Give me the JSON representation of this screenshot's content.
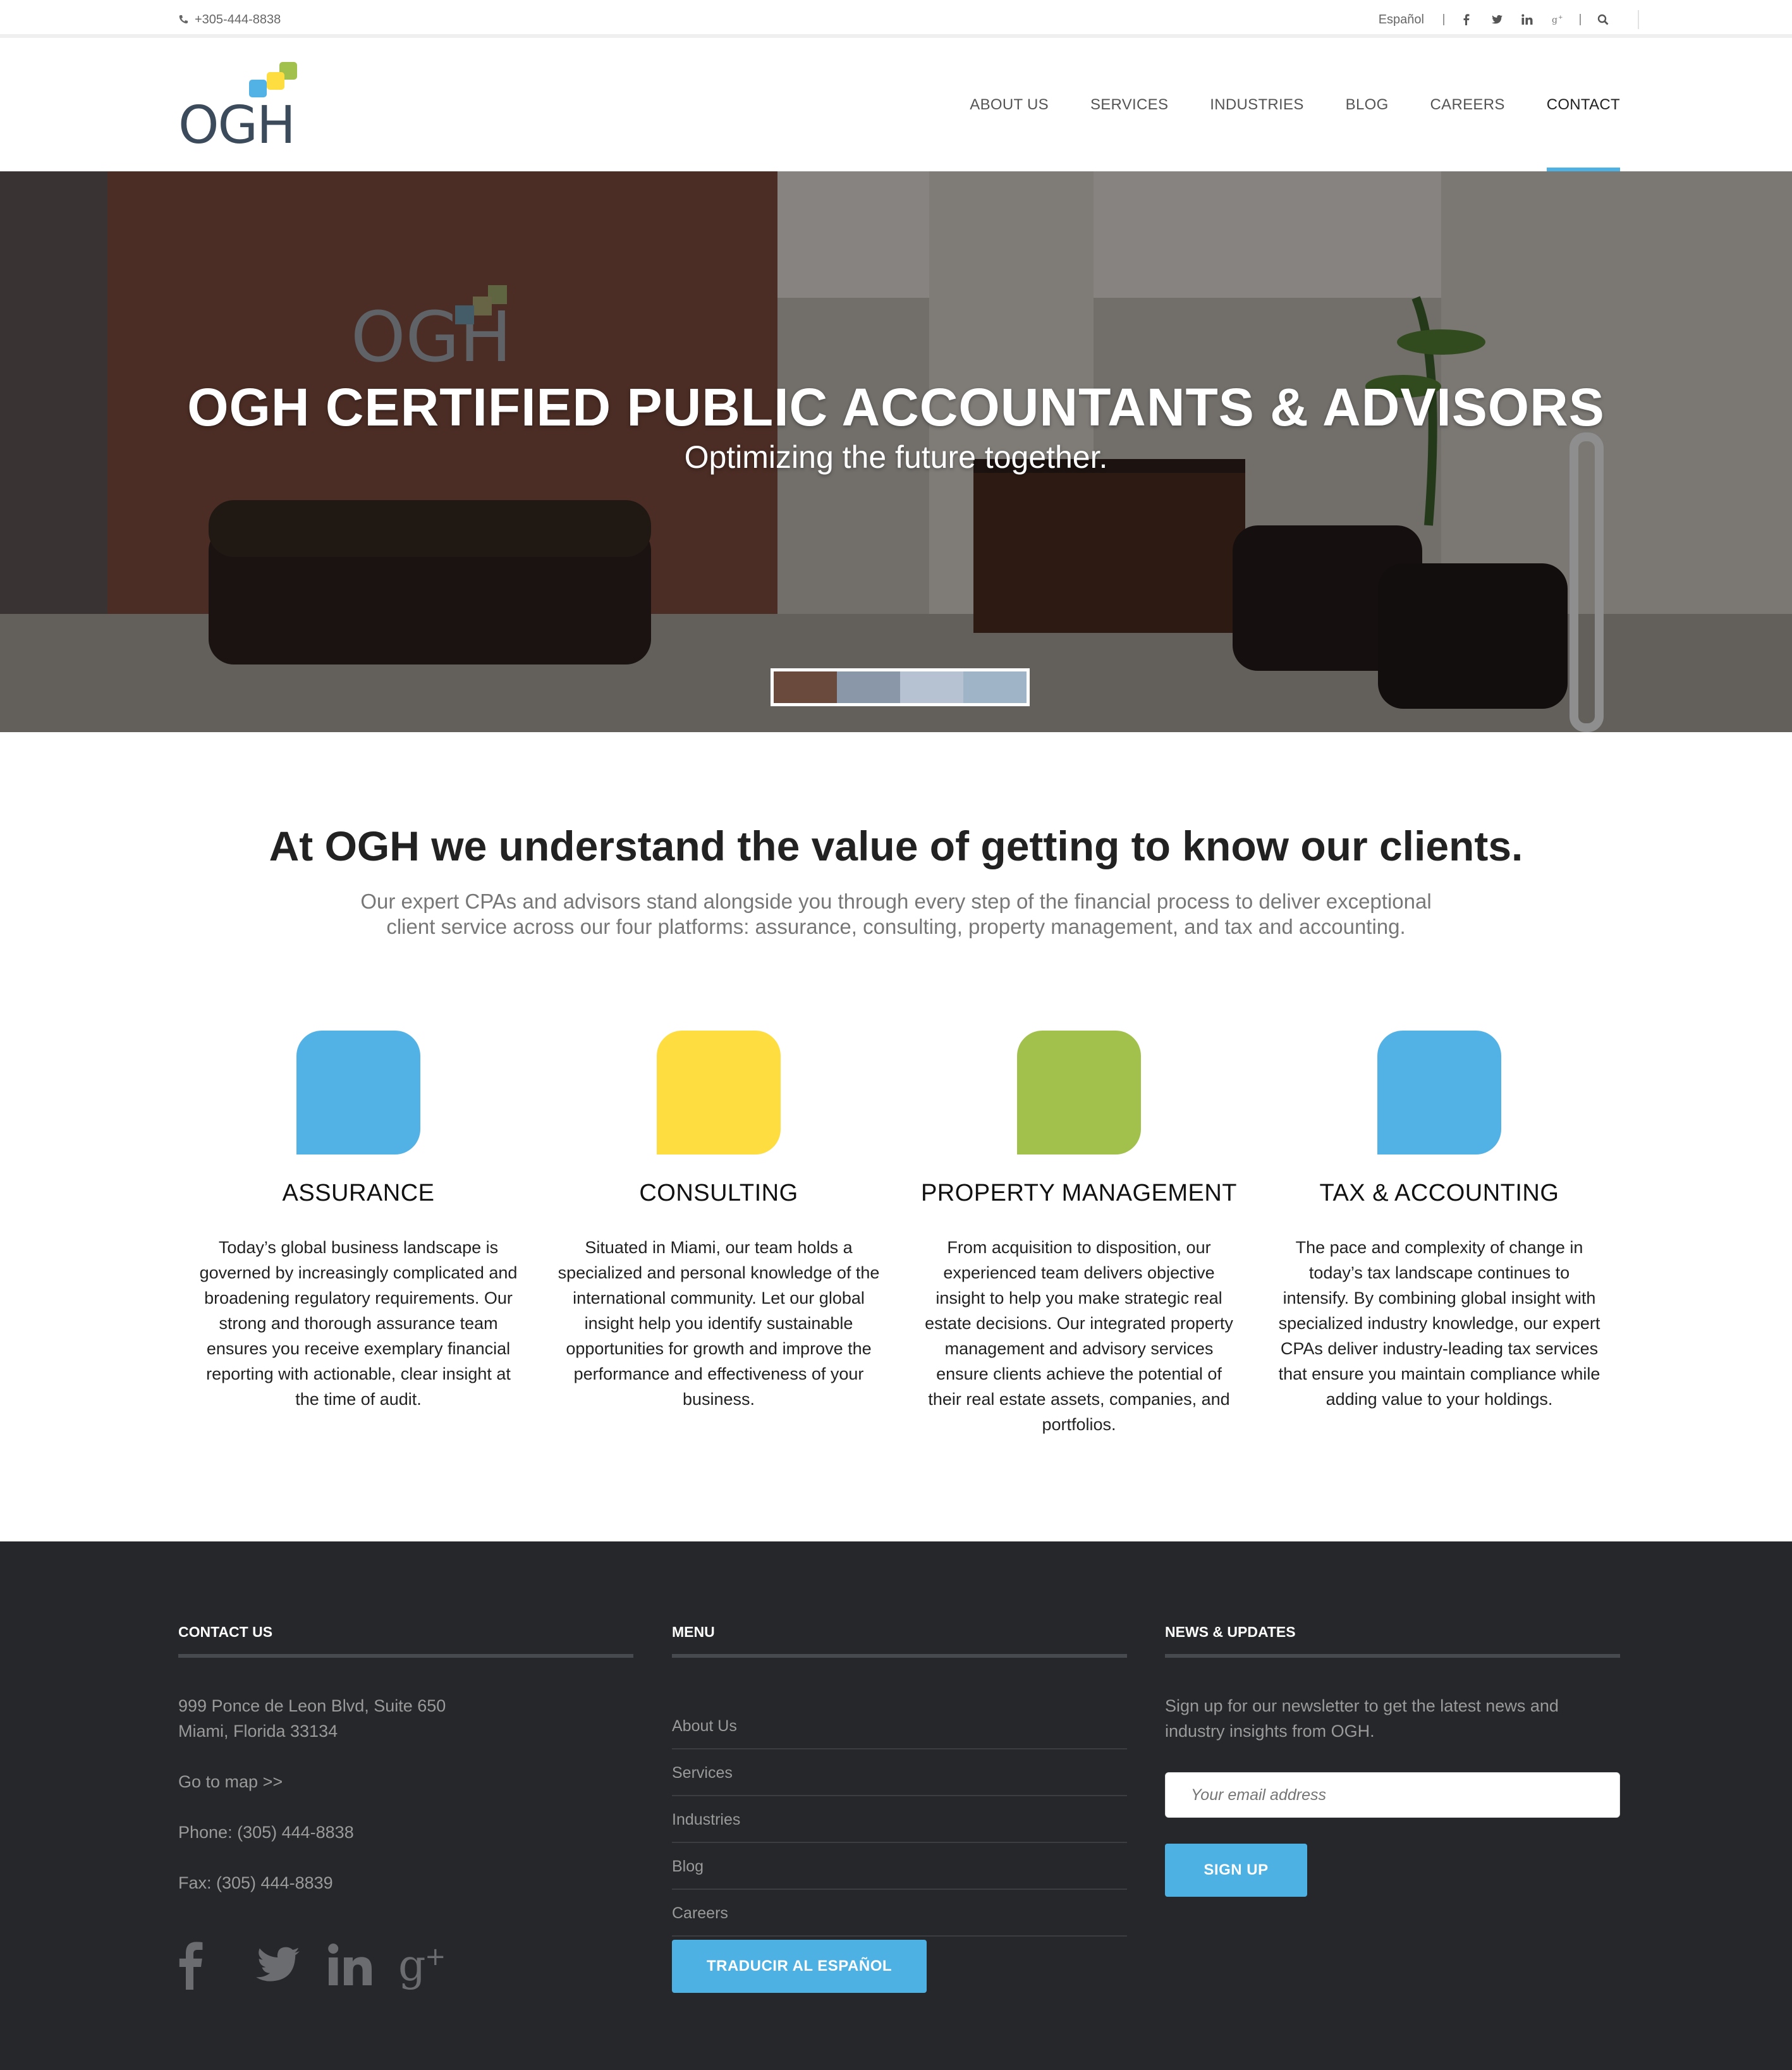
{
  "topbar": {
    "phone": "+305-444-8838",
    "language": "Español",
    "social_icons": [
      "facebook-icon",
      "twitter-icon",
      "linkedin-icon",
      "google-plus-icon"
    ],
    "search_icon": "search-icon"
  },
  "header": {
    "logo_text": "OGH",
    "nav": [
      {
        "label": "ABOUT US"
      },
      {
        "label": "SERVICES"
      },
      {
        "label": "INDUSTRIES"
      },
      {
        "label": "BLOG"
      },
      {
        "label": "CAREERS"
      },
      {
        "label": "CONTACT"
      }
    ],
    "active_nav": "CONTACT"
  },
  "hero": {
    "title": "OGH CERTIFIED PUBLIC ACCOUNTANTS & ADVISORS",
    "subtitle": "Optimizing the future together."
  },
  "intro": {
    "title": "At OGH we understand the value of getting to know our clients.",
    "text": "Our expert CPAs and advisors stand alongside you through every step of the financial process to deliver exceptional client service across our four platforms: assurance, consulting, property management, and tax and accounting."
  },
  "services": [
    {
      "title": "ASSURANCE",
      "color": "#53b2e5",
      "text": "Today’s global business landscape is governed by increasingly complicated and broadening regulatory requirements. Our strong and thorough assurance team ensures you receive exemplary financial reporting with actionable, clear insight at the time of audit."
    },
    {
      "title": "CONSULTING",
      "color": "#fddd40",
      "text": "Situated in Miami, our team holds a specialized and personal knowledge of the international community. Let our global insight help you identify sustainable opportunities for growth and improve the performance and effectiveness of your business."
    },
    {
      "title": "PROPERTY MANAGEMENT",
      "color": "#a2c04c",
      "text": "From acquisition to disposition, our experienced team delivers objective insight to help you make strategic real estate decisions. Our integrated property management and advisory services ensure clients achieve the potential of their real estate assets, companies, and portfolios."
    },
    {
      "title": "TAX & ACCOUNTING",
      "color": "#53b2e5",
      "text": "The pace and complexity of change in today’s tax landscape continues to intensify. By combining global insight with specialized industry knowledge, our expert CPAs deliver industry-leading tax services that ensure you maintain compliance while adding value to your holdings."
    }
  ],
  "footer": {
    "contact": {
      "heading": "CONTACT US",
      "address_line1": "999 Ponce de Leon Blvd, Suite 650",
      "address_line2": "Miami, Florida 33134",
      "map_link": "Go to map >>",
      "phone": "Phone: (305) 444-8838",
      "fax": "Fax: (305) 444-8839"
    },
    "menu": {
      "heading": "MENU",
      "items": [
        {
          "label": "About Us"
        },
        {
          "label": "Services"
        },
        {
          "label": "Industries"
        },
        {
          "label": "Blog"
        },
        {
          "label": "Careers"
        }
      ],
      "translate_button": "TRADUCIR AL ESPAÑOL"
    },
    "news": {
      "heading": "NEWS & UPDATES",
      "text": "Sign up for our newsletter to get the latest news and industry insights from OGH.",
      "email_placeholder": "Your email address",
      "signup_button": "SIGN UP"
    }
  },
  "colors": {
    "accent": "#4eb1e4",
    "footer_bg": "#25272a",
    "blue": "#53b2e5",
    "yellow": "#fddd40",
    "green": "#a2c04c"
  }
}
